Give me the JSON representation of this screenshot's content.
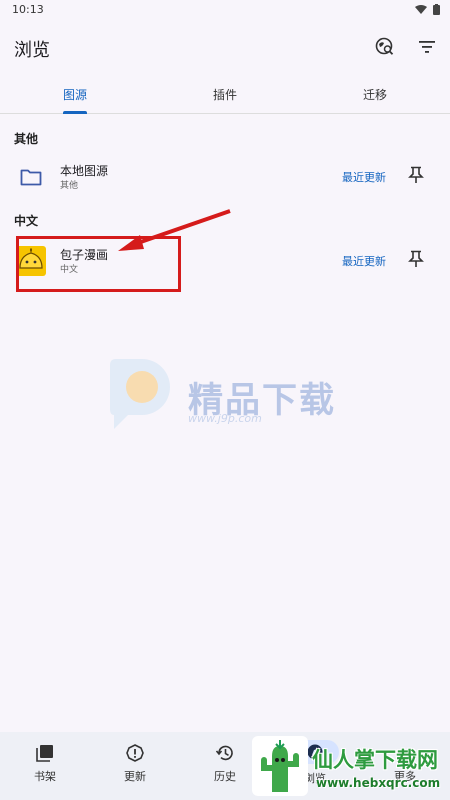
{
  "status": {
    "time": "10:13"
  },
  "app": {
    "title": "浏览"
  },
  "tabs": [
    {
      "label": "图源",
      "active": true
    },
    {
      "label": "插件",
      "active": false
    },
    {
      "label": "迁移",
      "active": false
    }
  ],
  "sections": [
    {
      "header": "其他",
      "source": {
        "name": "本地图源",
        "lang": "其他",
        "latest": "最近更新",
        "icon": "folder-icon"
      }
    },
    {
      "header": "中文",
      "source": {
        "name": "包子漫画",
        "lang": "中文",
        "latest": "最近更新",
        "icon": "baozi-icon"
      }
    }
  ],
  "watermark": {
    "text": "精品下载",
    "url": "www.j9p.com"
  },
  "bottom_nav": [
    {
      "label": "书架",
      "icon": "library-icon"
    },
    {
      "label": "更新",
      "icon": "updates-icon"
    },
    {
      "label": "历史",
      "icon": "history-icon"
    },
    {
      "label": "浏览",
      "icon": "browse-icon",
      "active": true
    },
    {
      "label": "更多",
      "icon": "more-icon"
    }
  ],
  "site_logo": {
    "text": "仙人掌下载网",
    "url": "www.hebxqrc.com"
  },
  "colors": {
    "accent": "#1565c0",
    "highlight": "#d51b1b",
    "background": "#f8f5fb"
  }
}
